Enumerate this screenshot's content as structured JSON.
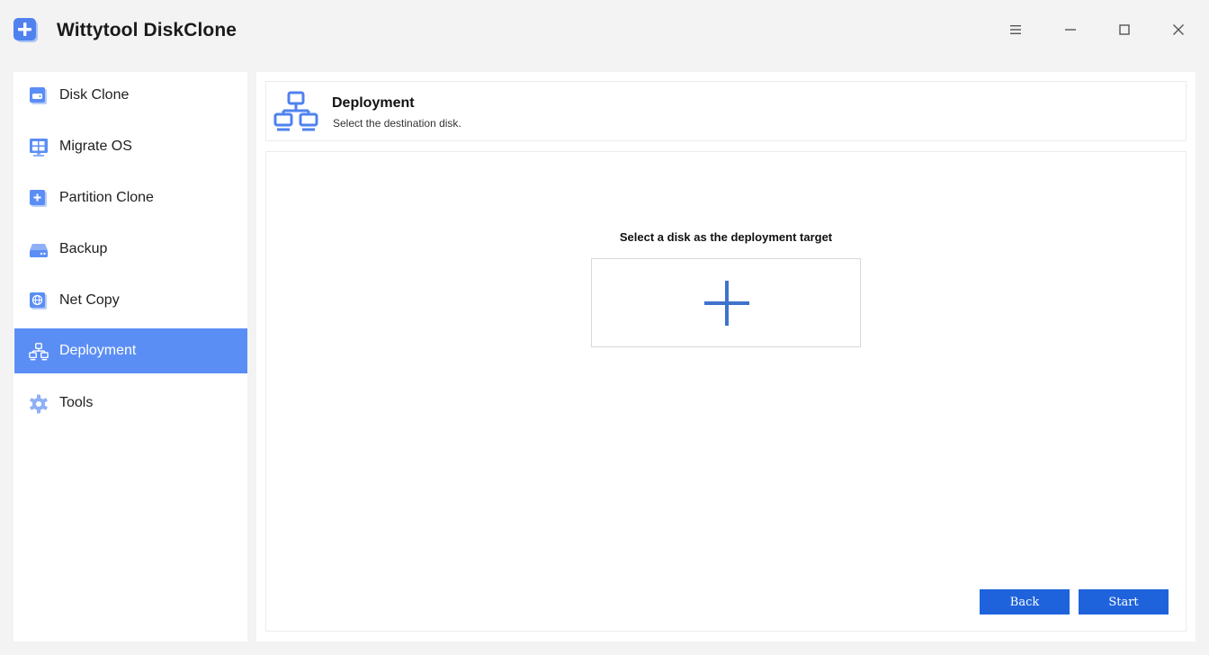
{
  "app": {
    "title": "Wittytool DiskClone",
    "logo_icon": "plus-square-icon",
    "accent_color": "#5b8ef5"
  },
  "window_controls": {
    "menu_icon": "hamburger-menu-icon",
    "minimize_icon": "minimize-icon",
    "maximize_icon": "maximize-icon",
    "close_icon": "close-icon"
  },
  "sidebar": {
    "items": [
      {
        "label": "Disk Clone",
        "icon": "disk-icon",
        "active": false
      },
      {
        "label": "Migrate OS",
        "icon": "windows-os-icon",
        "active": false
      },
      {
        "label": "Partition Clone",
        "icon": "partition-icon",
        "active": false
      },
      {
        "label": "Backup",
        "icon": "backup-drive-icon",
        "active": false
      },
      {
        "label": "Net Copy",
        "icon": "globe-icon",
        "active": false
      },
      {
        "label": "Deployment",
        "icon": "network-icon",
        "active": true
      },
      {
        "label": "Tools",
        "icon": "gear-icon",
        "active": false
      }
    ]
  },
  "header": {
    "title": "Deployment",
    "subtitle": "Select the destination disk.",
    "icon": "network-icon"
  },
  "content": {
    "prompt": "Select a disk as the deployment target",
    "add_disk_icon": "plus-icon"
  },
  "actions": {
    "back_label": "Back",
    "start_label": "Start",
    "button_color": "#1f63dc"
  }
}
